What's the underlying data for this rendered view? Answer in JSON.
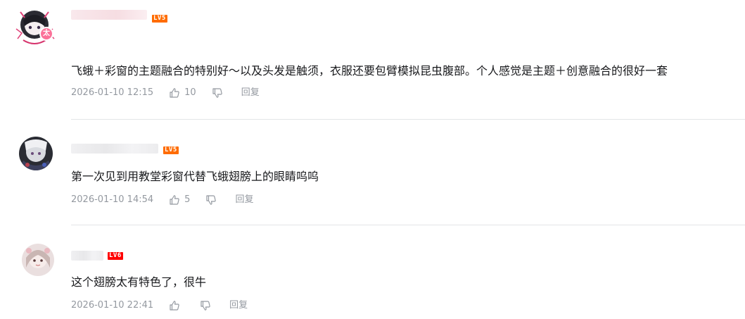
{
  "comments": [
    {
      "level": "LV5",
      "level_color": "#ff6c00",
      "text": "飞蛾＋彩窗的主题融合的特别好～以及头发是触须，衣服还要包臂模拟昆虫腹部。个人感觉是主题＋创意融合的很好一套",
      "time": "2026-01-10 12:15",
      "likes": "10",
      "reply_label": "回复",
      "avatar_badge": "太"
    },
    {
      "level": "LV5",
      "level_color": "#ff6c00",
      "text": "第一次见到用教堂彩窗代替飞蛾翅膀上的眼睛呜呜",
      "time": "2026-01-10 14:54",
      "likes": "5",
      "reply_label": "回复"
    },
    {
      "level": "LV6",
      "level_color": "#ff0000",
      "text": "这个翅膀太有特色了，很牛",
      "time": "2026-01-10 22:41",
      "likes": "",
      "reply_label": "回复"
    }
  ]
}
